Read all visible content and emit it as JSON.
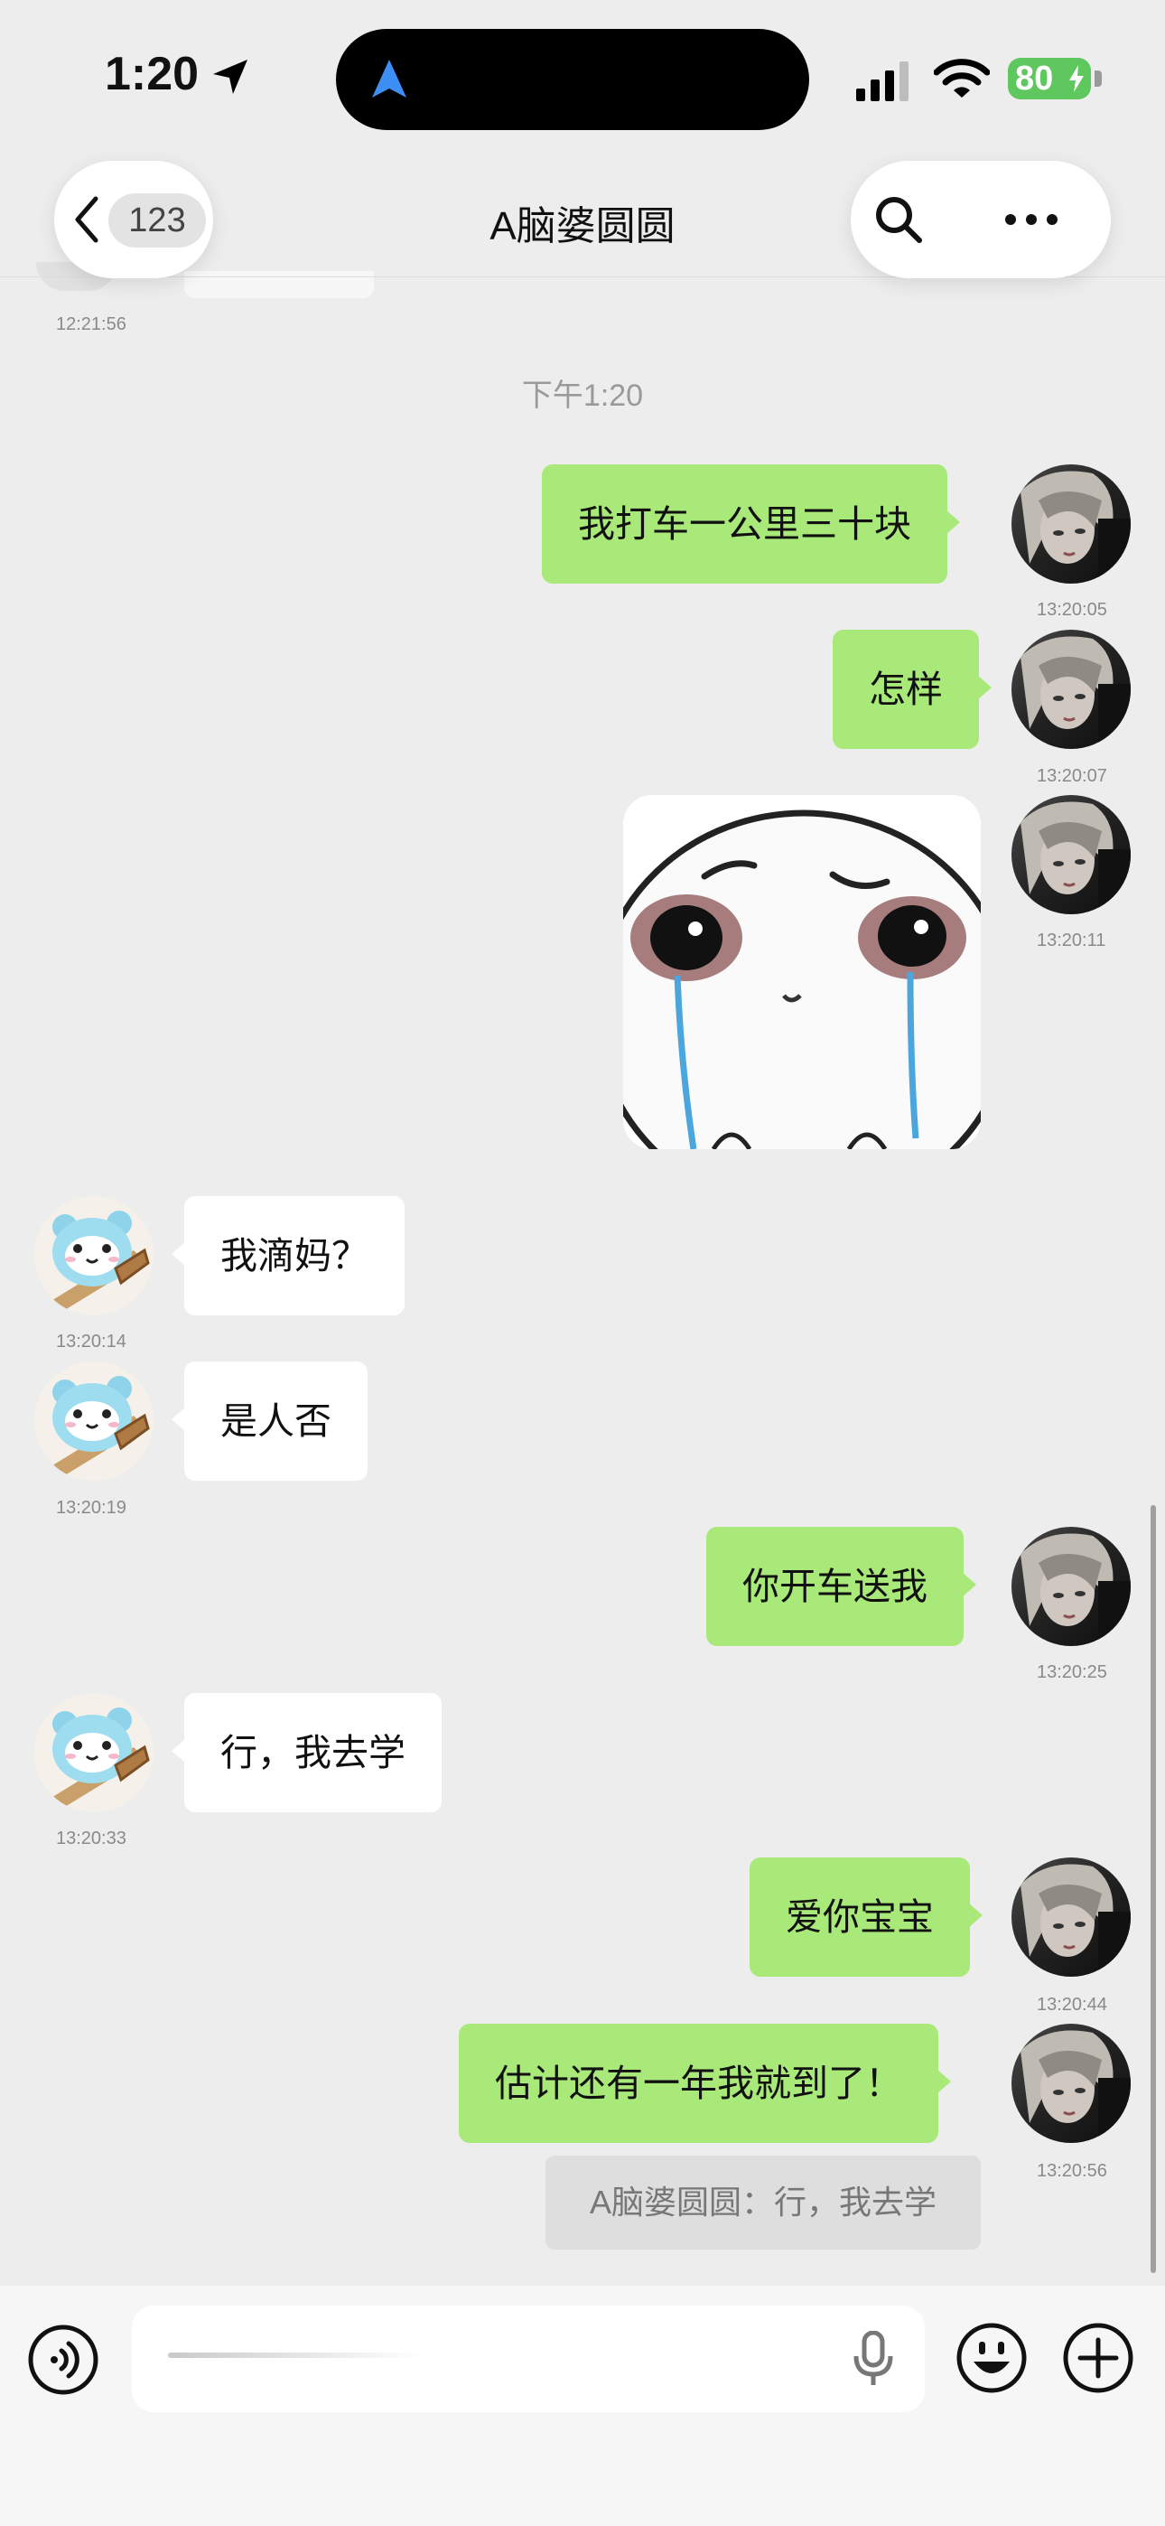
{
  "status_bar": {
    "time": "1:20",
    "battery": "80"
  },
  "header": {
    "back_count": "123",
    "title": "A脑婆圆圆"
  },
  "timestamps": {
    "peek": "12:21:56",
    "divider": "下午1:20"
  },
  "messages": [
    {
      "dir": "out",
      "text": "我打车一公里三十块",
      "time": "13:20:05"
    },
    {
      "dir": "out",
      "text": "怎样",
      "time": "13:20:07"
    },
    {
      "dir": "out",
      "type": "sticker",
      "time": "13:20:11"
    },
    {
      "dir": "in",
      "text": "我滴妈？",
      "time": "13:20:14"
    },
    {
      "dir": "in",
      "text": "是人否",
      "time": "13:20:19"
    },
    {
      "dir": "out",
      "text": "你开车送我",
      "time": "13:20:25"
    },
    {
      "dir": "in",
      "text": "行，我去学",
      "time": "13:20:33"
    },
    {
      "dir": "out",
      "text": "爱你宝宝",
      "time": "13:20:44"
    },
    {
      "dir": "out",
      "text": "估计还有一年我就到了！",
      "time": "13:20:56"
    }
  ],
  "quote": {
    "text": "A脑婆圆圆：行，我去学"
  },
  "icons": [
    "back-chevron-icon",
    "search-icon",
    "more-icon",
    "voice-icon",
    "microphone-icon",
    "emoji-icon",
    "plus-icon"
  ],
  "colors": {
    "outgoing_bubble": "#a9e97a",
    "incoming_bubble": "#ffffff",
    "background": "#ededed"
  }
}
